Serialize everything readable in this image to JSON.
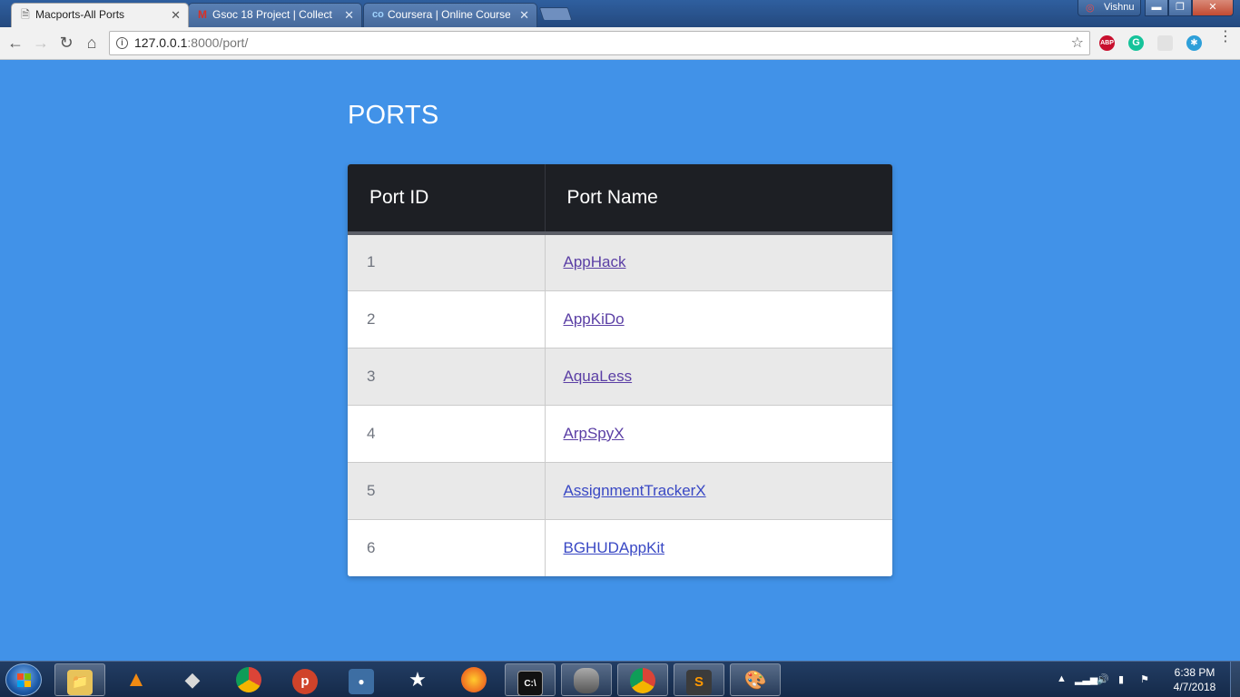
{
  "browser": {
    "tabs": [
      {
        "title": "Macports-All Ports",
        "icon": "page-icon",
        "active": true
      },
      {
        "title": "Gsoc 18 Project | Collect",
        "icon": "gmail-icon",
        "active": false
      },
      {
        "title": "Coursera | Online Course",
        "icon": "coursera-icon",
        "active": false
      }
    ],
    "profile_name": "Vishnu",
    "address": {
      "host": "127.0.0.1",
      "path": ":8000/port/"
    },
    "extensions": {
      "abp_label": "ABP"
    }
  },
  "page": {
    "title": "PORTS",
    "table": {
      "headers": [
        "Port ID",
        "Port Name"
      ],
      "rows": [
        {
          "id": "1",
          "name": "AppHack"
        },
        {
          "id": "2",
          "name": "AppKiDo"
        },
        {
          "id": "3",
          "name": "AquaLess"
        },
        {
          "id": "4",
          "name": "ArpSpyX"
        },
        {
          "id": "5",
          "name": "AssignmentTrackerX"
        },
        {
          "id": "6",
          "name": "BGHUDAppKit"
        }
      ]
    }
  },
  "taskbar": {
    "apps": [
      "windows-explorer-icon",
      "vlc-icon",
      "inkscape-icon",
      "chrome-icon",
      "psiphon-icon",
      "app-window-icon",
      "counter-strike-icon",
      "firefox-icon",
      "cmd-icon",
      "database-icon",
      "chrome-active-icon",
      "sublime-text-icon",
      "paint-icon"
    ],
    "clock_time": "6:38 PM",
    "clock_date": "4/7/2018"
  },
  "colors": {
    "page_background": "#4192e8",
    "table_header": "#1d1f24",
    "link": "#3948c4",
    "visited_link": "#5b3fa5"
  }
}
